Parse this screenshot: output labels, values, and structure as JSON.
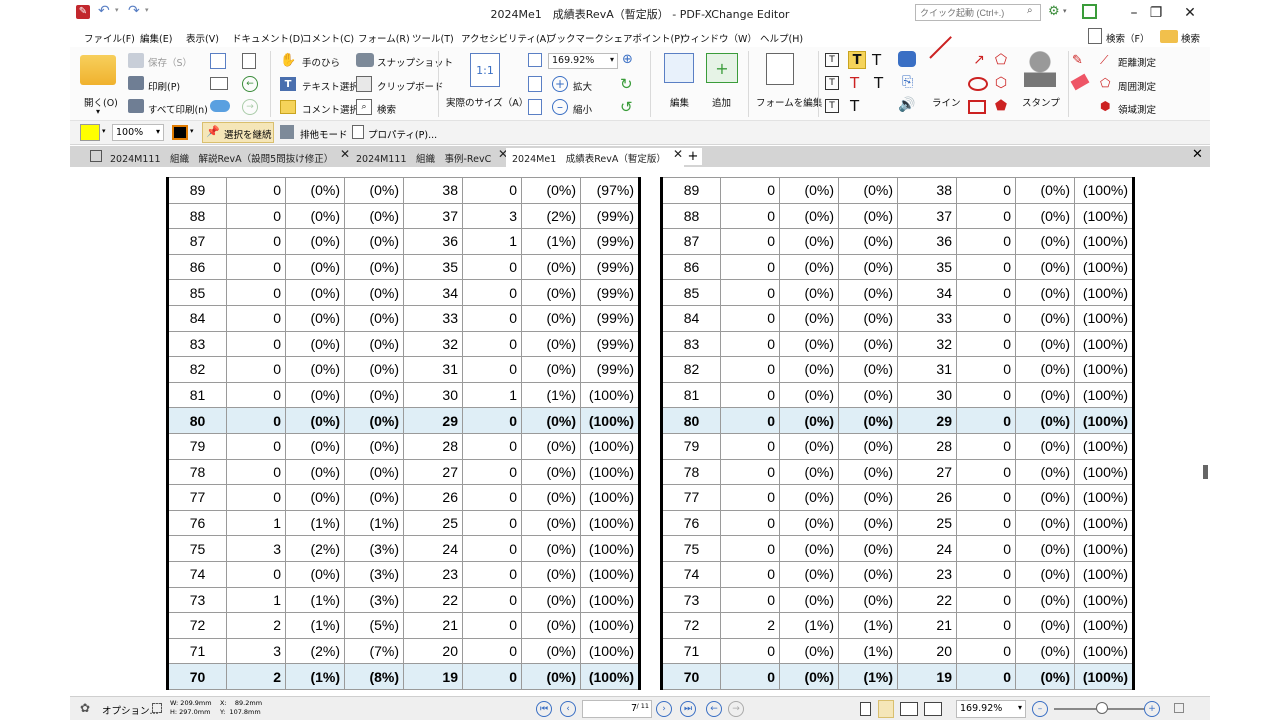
{
  "window": {
    "title": "2024Me1　成績表RevA（暫定版） - PDF-XChange Editor",
    "quick_launch_placeholder": "クイック起動 (Ctrl+.)"
  },
  "menu": [
    "ファイル(F)",
    "編集(E)",
    "表示(V)",
    "ドキュメント(D)",
    "コメント(C)",
    "フォーム(R)",
    "ツール(T)",
    "アクセシビリティ(A)",
    "ブックマーク",
    "シェアポイント(P)",
    "ウィンドウ（W）",
    "ヘルプ(H)"
  ],
  "menu_right": {
    "search": "検索（F）",
    "search2": "検索"
  },
  "ribbon": {
    "open": "開く(O)",
    "save": "保存（S）",
    "print": "印刷(P)",
    "print_all": "すべて印刷(n)",
    "hand": "手のひら",
    "text_select": "テキスト選択",
    "comment_select": "コメント選択",
    "snapshot": "スナップショット",
    "clipboard": "クリップボード",
    "search": "検索",
    "actual_size": "実際のサイズ（A）",
    "zoom_value": "169.92%",
    "zoom_in": "拡大",
    "zoom_out": "縮小",
    "edit": "編集",
    "add": "追加",
    "edit_form": "フォームを編集",
    "line": "ライン",
    "stamp": "スタンプ",
    "dist_measure": "距離測定",
    "perim_measure": "周囲測定",
    "area_measure": "領域測定"
  },
  "propbar": {
    "opacity": "100%",
    "keep_selection": "選択を継続",
    "exclusive_mode": "排他モード",
    "properties": "プロパティ(P)..."
  },
  "tabs": [
    {
      "label": "2024M111　組織　解説RevA（設問5問抜け修正）"
    },
    {
      "label": "2024M111　組織　事例-RevC"
    },
    {
      "label": "2024Me1　成績表RevA（暫定版）"
    }
  ],
  "left_table": [
    {
      "score": "89",
      "c1": "0",
      "c2": "(0%)",
      "c3": "(0%)",
      "c4": "38",
      "c5": "0",
      "c6": "(0%)",
      "c7": "(97%)",
      "hl": false
    },
    {
      "score": "88",
      "c1": "0",
      "c2": "(0%)",
      "c3": "(0%)",
      "c4": "37",
      "c5": "3",
      "c6": "(2%)",
      "c7": "(99%)",
      "hl": false
    },
    {
      "score": "87",
      "c1": "0",
      "c2": "(0%)",
      "c3": "(0%)",
      "c4": "36",
      "c5": "1",
      "c6": "(1%)",
      "c7": "(99%)",
      "hl": false
    },
    {
      "score": "86",
      "c1": "0",
      "c2": "(0%)",
      "c3": "(0%)",
      "c4": "35",
      "c5": "0",
      "c6": "(0%)",
      "c7": "(99%)",
      "hl": false
    },
    {
      "score": "85",
      "c1": "0",
      "c2": "(0%)",
      "c3": "(0%)",
      "c4": "34",
      "c5": "0",
      "c6": "(0%)",
      "c7": "(99%)",
      "hl": false
    },
    {
      "score": "84",
      "c1": "0",
      "c2": "(0%)",
      "c3": "(0%)",
      "c4": "33",
      "c5": "0",
      "c6": "(0%)",
      "c7": "(99%)",
      "hl": false
    },
    {
      "score": "83",
      "c1": "0",
      "c2": "(0%)",
      "c3": "(0%)",
      "c4": "32",
      "c5": "0",
      "c6": "(0%)",
      "c7": "(99%)",
      "hl": false
    },
    {
      "score": "82",
      "c1": "0",
      "c2": "(0%)",
      "c3": "(0%)",
      "c4": "31",
      "c5": "0",
      "c6": "(0%)",
      "c7": "(99%)",
      "hl": false
    },
    {
      "score": "81",
      "c1": "0",
      "c2": "(0%)",
      "c3": "(0%)",
      "c4": "30",
      "c5": "1",
      "c6": "(1%)",
      "c7": "(100%)",
      "hl": false
    },
    {
      "score": "80",
      "c1": "0",
      "c2": "(0%)",
      "c3": "(0%)",
      "c4": "29",
      "c5": "0",
      "c6": "(0%)",
      "c7": "(100%)",
      "hl": true
    },
    {
      "score": "79",
      "c1": "0",
      "c2": "(0%)",
      "c3": "(0%)",
      "c4": "28",
      "c5": "0",
      "c6": "(0%)",
      "c7": "(100%)",
      "hl": false
    },
    {
      "score": "78",
      "c1": "0",
      "c2": "(0%)",
      "c3": "(0%)",
      "c4": "27",
      "c5": "0",
      "c6": "(0%)",
      "c7": "(100%)",
      "hl": false
    },
    {
      "score": "77",
      "c1": "0",
      "c2": "(0%)",
      "c3": "(0%)",
      "c4": "26",
      "c5": "0",
      "c6": "(0%)",
      "c7": "(100%)",
      "hl": false
    },
    {
      "score": "76",
      "c1": "1",
      "c2": "(1%)",
      "c3": "(1%)",
      "c4": "25",
      "c5": "0",
      "c6": "(0%)",
      "c7": "(100%)",
      "hl": false
    },
    {
      "score": "75",
      "c1": "3",
      "c2": "(2%)",
      "c3": "(3%)",
      "c4": "24",
      "c5": "0",
      "c6": "(0%)",
      "c7": "(100%)",
      "hl": false
    },
    {
      "score": "74",
      "c1": "0",
      "c2": "(0%)",
      "c3": "(3%)",
      "c4": "23",
      "c5": "0",
      "c6": "(0%)",
      "c7": "(100%)",
      "hl": false
    },
    {
      "score": "73",
      "c1": "1",
      "c2": "(1%)",
      "c3": "(3%)",
      "c4": "22",
      "c5": "0",
      "c6": "(0%)",
      "c7": "(100%)",
      "hl": false
    },
    {
      "score": "72",
      "c1": "2",
      "c2": "(1%)",
      "c3": "(5%)",
      "c4": "21",
      "c5": "0",
      "c6": "(0%)",
      "c7": "(100%)",
      "hl": false
    },
    {
      "score": "71",
      "c1": "3",
      "c2": "(2%)",
      "c3": "(7%)",
      "c4": "20",
      "c5": "0",
      "c6": "(0%)",
      "c7": "(100%)",
      "hl": false
    },
    {
      "score": "70",
      "c1": "2",
      "c2": "(1%)",
      "c3": "(8%)",
      "c4": "19",
      "c5": "0",
      "c6": "(0%)",
      "c7": "(100%)",
      "hl": true
    }
  ],
  "right_table": [
    {
      "score": "89",
      "c1": "0",
      "c2": "(0%)",
      "c3": "(0%)",
      "c4": "38",
      "c5": "0",
      "c6": "(0%)",
      "c7": "(100%)",
      "hl": false
    },
    {
      "score": "88",
      "c1": "0",
      "c2": "(0%)",
      "c3": "(0%)",
      "c4": "37",
      "c5": "0",
      "c6": "(0%)",
      "c7": "(100%)",
      "hl": false
    },
    {
      "score": "87",
      "c1": "0",
      "c2": "(0%)",
      "c3": "(0%)",
      "c4": "36",
      "c5": "0",
      "c6": "(0%)",
      "c7": "(100%)",
      "hl": false
    },
    {
      "score": "86",
      "c1": "0",
      "c2": "(0%)",
      "c3": "(0%)",
      "c4": "35",
      "c5": "0",
      "c6": "(0%)",
      "c7": "(100%)",
      "hl": false
    },
    {
      "score": "85",
      "c1": "0",
      "c2": "(0%)",
      "c3": "(0%)",
      "c4": "34",
      "c5": "0",
      "c6": "(0%)",
      "c7": "(100%)",
      "hl": false
    },
    {
      "score": "84",
      "c1": "0",
      "c2": "(0%)",
      "c3": "(0%)",
      "c4": "33",
      "c5": "0",
      "c6": "(0%)",
      "c7": "(100%)",
      "hl": false
    },
    {
      "score": "83",
      "c1": "0",
      "c2": "(0%)",
      "c3": "(0%)",
      "c4": "32",
      "c5": "0",
      "c6": "(0%)",
      "c7": "(100%)",
      "hl": false
    },
    {
      "score": "82",
      "c1": "0",
      "c2": "(0%)",
      "c3": "(0%)",
      "c4": "31",
      "c5": "0",
      "c6": "(0%)",
      "c7": "(100%)",
      "hl": false
    },
    {
      "score": "81",
      "c1": "0",
      "c2": "(0%)",
      "c3": "(0%)",
      "c4": "30",
      "c5": "0",
      "c6": "(0%)",
      "c7": "(100%)",
      "hl": false
    },
    {
      "score": "80",
      "c1": "0",
      "c2": "(0%)",
      "c3": "(0%)",
      "c4": "29",
      "c5": "0",
      "c6": "(0%)",
      "c7": "(100%)",
      "hl": true
    },
    {
      "score": "79",
      "c1": "0",
      "c2": "(0%)",
      "c3": "(0%)",
      "c4": "28",
      "c5": "0",
      "c6": "(0%)",
      "c7": "(100%)",
      "hl": false
    },
    {
      "score": "78",
      "c1": "0",
      "c2": "(0%)",
      "c3": "(0%)",
      "c4": "27",
      "c5": "0",
      "c6": "(0%)",
      "c7": "(100%)",
      "hl": false
    },
    {
      "score": "77",
      "c1": "0",
      "c2": "(0%)",
      "c3": "(0%)",
      "c4": "26",
      "c5": "0",
      "c6": "(0%)",
      "c7": "(100%)",
      "hl": false
    },
    {
      "score": "76",
      "c1": "0",
      "c2": "(0%)",
      "c3": "(0%)",
      "c4": "25",
      "c5": "0",
      "c6": "(0%)",
      "c7": "(100%)",
      "hl": false
    },
    {
      "score": "75",
      "c1": "0",
      "c2": "(0%)",
      "c3": "(0%)",
      "c4": "24",
      "c5": "0",
      "c6": "(0%)",
      "c7": "(100%)",
      "hl": false
    },
    {
      "score": "74",
      "c1": "0",
      "c2": "(0%)",
      "c3": "(0%)",
      "c4": "23",
      "c5": "0",
      "c6": "(0%)",
      "c7": "(100%)",
      "hl": false
    },
    {
      "score": "73",
      "c1": "0",
      "c2": "(0%)",
      "c3": "(0%)",
      "c4": "22",
      "c5": "0",
      "c6": "(0%)",
      "c7": "(100%)",
      "hl": false
    },
    {
      "score": "72",
      "c1": "2",
      "c2": "(1%)",
      "c3": "(1%)",
      "c4": "21",
      "c5": "0",
      "c6": "(0%)",
      "c7": "(100%)",
      "hl": false
    },
    {
      "score": "71",
      "c1": "0",
      "c2": "(0%)",
      "c3": "(1%)",
      "c4": "20",
      "c5": "0",
      "c6": "(0%)",
      "c7": "(100%)",
      "hl": false
    },
    {
      "score": "70",
      "c1": "0",
      "c2": "(0%)",
      "c3": "(1%)",
      "c4": "19",
      "c5": "0",
      "c6": "(0%)",
      "c7": "(100%)",
      "hl": true
    }
  ],
  "statusbar": {
    "options": "オプション...",
    "dim_w": "W: 209.9mm",
    "dim_h": "H: 297.0mm",
    "pos_x": "X:    89.2mm",
    "pos_y": "Y:  107.8mm",
    "page_current": "7",
    "page_total": "/ 11",
    "zoom": "169.92%"
  },
  "colors": {
    "accent_blue": "#3a6fc4",
    "highlight_row": "#dfeef6",
    "tab_bar": "#d4d4d4"
  }
}
